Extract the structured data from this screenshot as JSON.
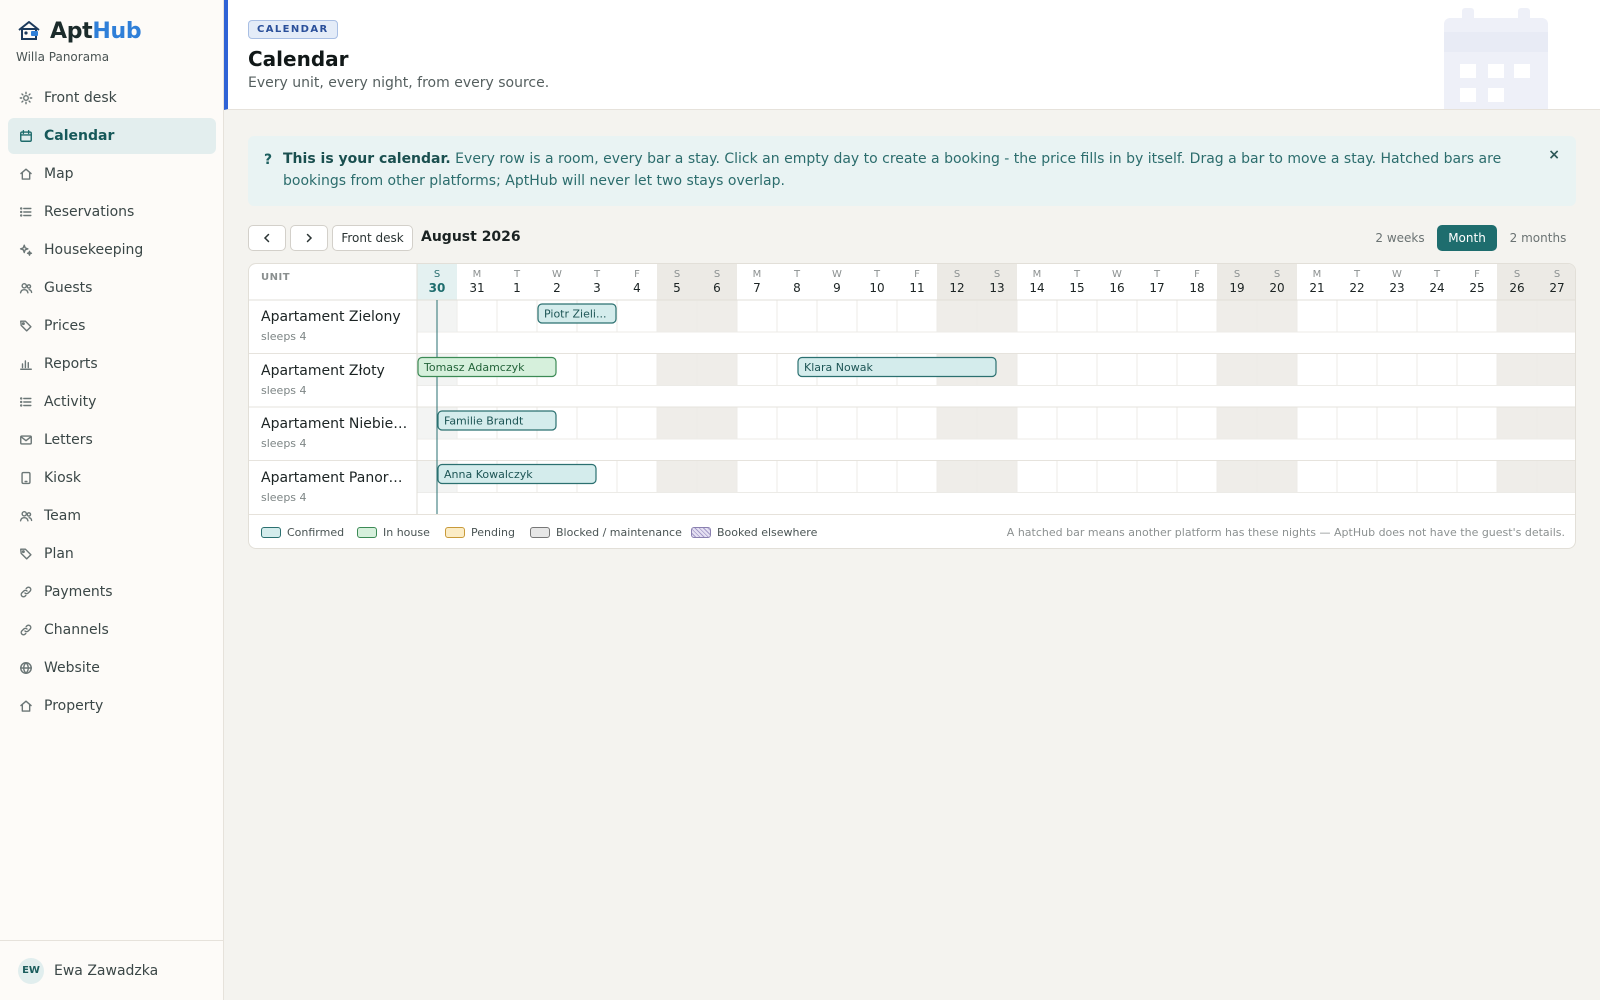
{
  "app": {
    "brand_a": "Apt",
    "brand_b": "Hub",
    "property": "Willa Panorama"
  },
  "sidebar": {
    "items": [
      {
        "label": "Front desk",
        "icon": "sun-icon"
      },
      {
        "label": "Calendar",
        "icon": "calendar-icon",
        "active": true
      },
      {
        "label": "Map",
        "icon": "home-icon"
      },
      {
        "label": "Reservations",
        "icon": "list-icon"
      },
      {
        "label": "Housekeeping",
        "icon": "sparkle-icon"
      },
      {
        "label": "Guests",
        "icon": "users-icon"
      },
      {
        "label": "Prices",
        "icon": "tag-icon"
      },
      {
        "label": "Reports",
        "icon": "bar-chart-icon"
      },
      {
        "label": "Activity",
        "icon": "list-icon"
      },
      {
        "label": "Letters",
        "icon": "mail-icon"
      },
      {
        "label": "Kiosk",
        "icon": "tablet-icon"
      },
      {
        "label": "Team",
        "icon": "users-icon"
      },
      {
        "label": "Plan",
        "icon": "tag-icon"
      },
      {
        "label": "Payments",
        "icon": "link-icon"
      },
      {
        "label": "Channels",
        "icon": "link-icon"
      },
      {
        "label": "Website",
        "icon": "globe-icon"
      },
      {
        "label": "Property",
        "icon": "home-icon"
      }
    ],
    "user": {
      "initials": "EW",
      "name": "Ewa Zawadzka"
    }
  },
  "header": {
    "tag": "CALENDAR",
    "title": "Calendar",
    "subtitle": "Every unit, every night, from every source."
  },
  "info": {
    "mark": "?",
    "bold": "This is your calendar.",
    "text": " Every row is a room, every bar a stay. Click an empty day to create a booking - the price fills in by itself. Drag a bar to move a stay. Hatched bars are bookings from other platforms; AptHub will never let two stays overlap.",
    "close": "×"
  },
  "toolbar": {
    "front_desk": "Front desk",
    "month": "August 2026",
    "views": [
      {
        "label": "2 weeks"
      },
      {
        "label": "Month",
        "active": true
      },
      {
        "label": "2 months"
      }
    ]
  },
  "calendar": {
    "unit_header": "UNIT",
    "days": [
      {
        "dow": "S",
        "d": "30",
        "we": false,
        "today": true
      },
      {
        "dow": "M",
        "d": "31",
        "we": false
      },
      {
        "dow": "T",
        "d": "1",
        "we": false
      },
      {
        "dow": "W",
        "d": "2",
        "we": false
      },
      {
        "dow": "T",
        "d": "3",
        "we": false
      },
      {
        "dow": "F",
        "d": "4",
        "we": false
      },
      {
        "dow": "S",
        "d": "5",
        "we": true
      },
      {
        "dow": "S",
        "d": "6",
        "we": true
      },
      {
        "dow": "M",
        "d": "7",
        "we": false
      },
      {
        "dow": "T",
        "d": "8",
        "we": false
      },
      {
        "dow": "W",
        "d": "9",
        "we": false
      },
      {
        "dow": "T",
        "d": "10",
        "we": false
      },
      {
        "dow": "F",
        "d": "11",
        "we": false
      },
      {
        "dow": "S",
        "d": "12",
        "we": true
      },
      {
        "dow": "S",
        "d": "13",
        "we": true
      },
      {
        "dow": "M",
        "d": "14",
        "we": false
      },
      {
        "dow": "T",
        "d": "15",
        "we": false
      },
      {
        "dow": "W",
        "d": "16",
        "we": false
      },
      {
        "dow": "T",
        "d": "17",
        "we": false
      },
      {
        "dow": "F",
        "d": "18",
        "we": false
      },
      {
        "dow": "S",
        "d": "19",
        "we": true
      },
      {
        "dow": "S",
        "d": "20",
        "we": true
      },
      {
        "dow": "M",
        "d": "21",
        "we": false
      },
      {
        "dow": "T",
        "d": "22",
        "we": false
      },
      {
        "dow": "W",
        "d": "23",
        "we": false
      },
      {
        "dow": "T",
        "d": "24",
        "we": false
      },
      {
        "dow": "F",
        "d": "25",
        "we": false
      },
      {
        "dow": "S",
        "d": "26",
        "we": true
      },
      {
        "dow": "S",
        "d": "27",
        "we": true
      }
    ],
    "units": [
      {
        "name": "Apartament Zielony",
        "sleeps": "sleeps 4"
      },
      {
        "name": "Apartament Złoty",
        "sleeps": "sleeps 4"
      },
      {
        "name": "Apartament Niebieski",
        "sleeps": "sleeps 4"
      },
      {
        "name": "Apartament Panorama",
        "sleeps": "sleeps 4"
      }
    ],
    "bookings": [
      {
        "row": 0,
        "start": 3,
        "end": 5,
        "label": "Piotr Zieli...",
        "status": "confirmed"
      },
      {
        "row": 1,
        "start": 0,
        "end": 3.5,
        "label": "Tomasz Adamczyk",
        "status": "inhouse"
      },
      {
        "row": 1,
        "start": 9.5,
        "end": 14.5,
        "label": "Klara Nowak",
        "status": "confirmed"
      },
      {
        "row": 2,
        "start": 0.5,
        "end": 3.5,
        "label": "Familie Brandt",
        "status": "confirmed"
      },
      {
        "row": 3,
        "start": 0.5,
        "end": 4.5,
        "label": "Anna Kowalczyk",
        "status": "confirmed"
      }
    ],
    "status_colors": {
      "confirmed": {
        "fill": "#d4ecec",
        "stroke": "#2b7070",
        "text": "#1d5555"
      },
      "inhouse": {
        "fill": "#d6f0dc",
        "stroke": "#3c8a55",
        "text": "#24643a"
      },
      "pending": {
        "fill": "#fbecc6",
        "stroke": "#c89a3a"
      },
      "blocked": {
        "fill": "#e6e6e6",
        "stroke": "#777777"
      },
      "elsewhere": {
        "fill": "#e5e0f2",
        "stroke": "#8a80b0"
      }
    }
  },
  "legend": {
    "items": [
      "Confirmed",
      "In house",
      "Pending",
      "Blocked / maintenance",
      "Booked elsewhere"
    ],
    "note": "A hatched bar means another platform has these nights — AptHub does not have the guest's details."
  }
}
